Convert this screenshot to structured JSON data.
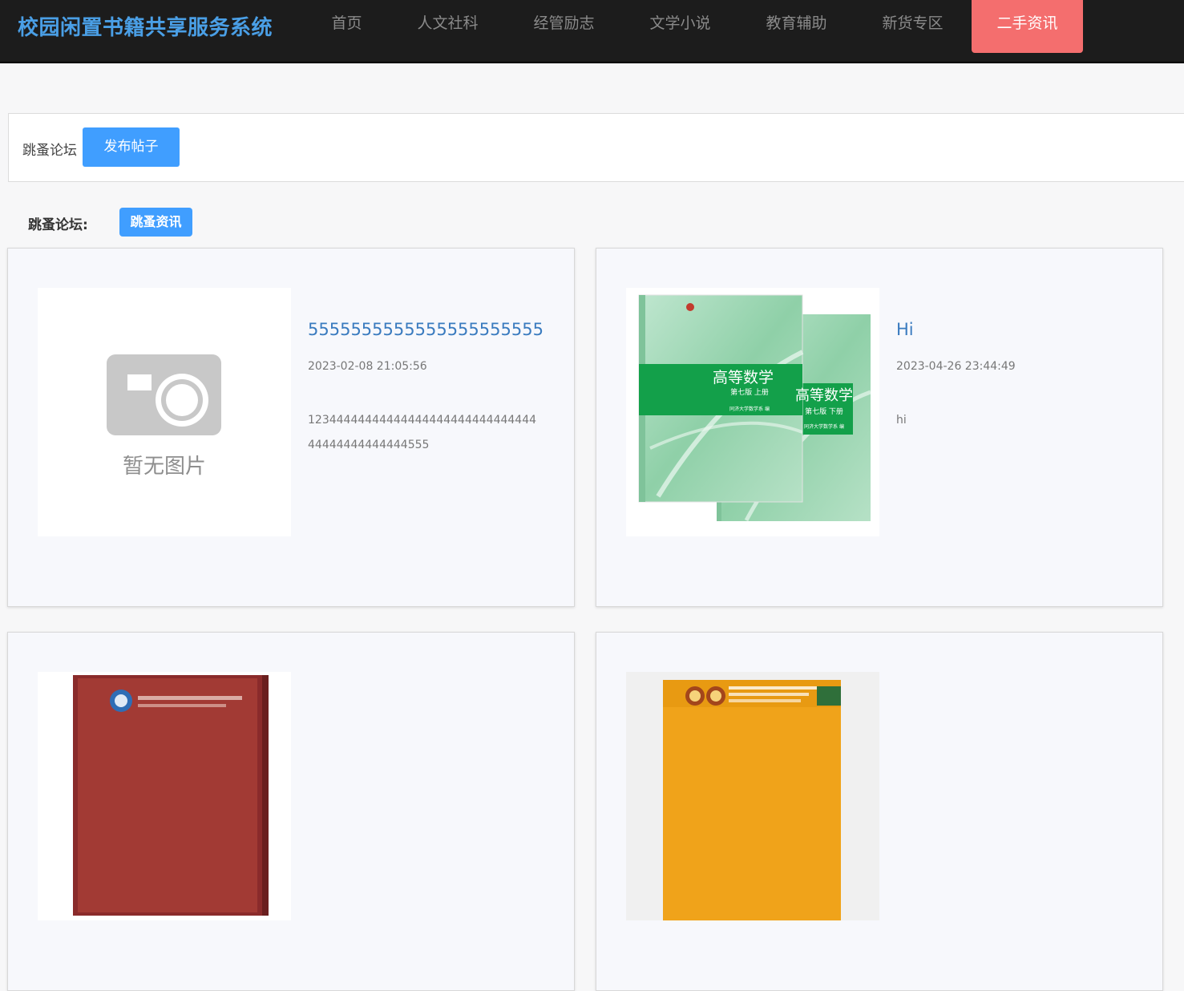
{
  "header": {
    "brand": "校园闲置书籍共享服务系统",
    "nav": [
      {
        "label": "首页"
      },
      {
        "label": "人文社科"
      },
      {
        "label": "经管励志"
      },
      {
        "label": "文学小说"
      },
      {
        "label": "教育辅助"
      },
      {
        "label": "新货专区"
      },
      {
        "label": "二手资讯",
        "active": true
      }
    ]
  },
  "forum_bar": {
    "label": "跳蚤论坛",
    "post_button": "发布帖子"
  },
  "filter": {
    "label": "跳蚤论坛:",
    "tag": "跳蚤资讯"
  },
  "posts": [
    {
      "title": "5555555555555555555555",
      "date": "2023-02-08 21:05:56",
      "content": "1234444444444444444444444444444444444444444444555",
      "image_placeholder": "暂无图片"
    },
    {
      "title": "Hi",
      "date": "2023-04-26 23:44:49",
      "content": "hi",
      "book_title": "高等数学",
      "book_edition_1": "第七版 上册",
      "book_edition_2": "第七版 下册",
      "book_author": "同济大学数学系 编"
    },
    {},
    {}
  ],
  "colors": {
    "topbar": "#1c1c1c",
    "brand": "#4a9fe6",
    "active_nav": "#f46e6e",
    "primary": "#409eff",
    "link": "#3a7bbf"
  }
}
